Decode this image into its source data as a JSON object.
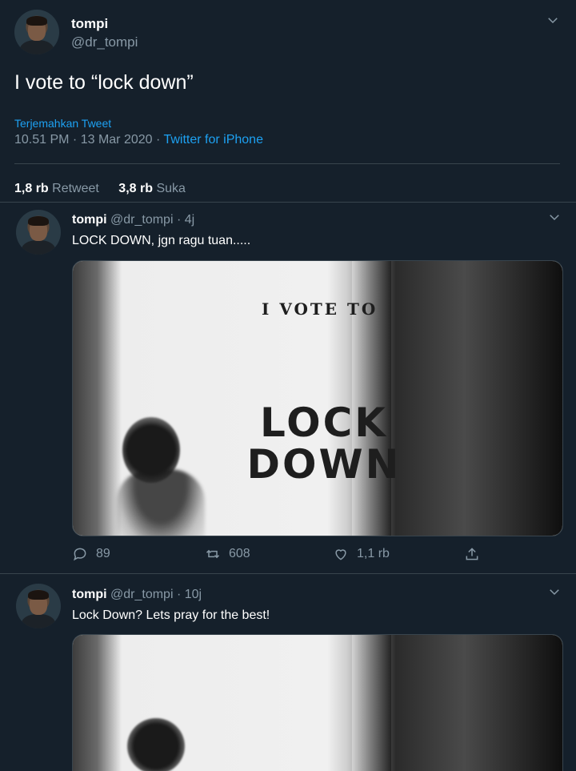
{
  "main_tweet": {
    "name": "tompi",
    "handle": "@dr_tompi",
    "text": "I vote to “lock down”",
    "translate_label": "Terjemahkan Tweet",
    "timestamp": "10.51 PM · 13 Mar 2020 ·",
    "client": "Twitter for iPhone",
    "retweet_count": "1,8 rb",
    "retweet_label": "Retweet",
    "like_count": "3,8 rb",
    "like_label": "Suka"
  },
  "replies": [
    {
      "name": "tompi",
      "handle_time": "@dr_tompi · 4j",
      "text": "LOCK DOWN, jgn ragu tuan.....",
      "image_text_small": "I VOTE TO",
      "image_text_big_line1": "LOCK",
      "image_text_big_line2": "DOWN",
      "reply_count": "89",
      "retweet_count": "608",
      "like_count": "1,1 rb"
    },
    {
      "name": "tompi",
      "handle_time": "@dr_tompi · 10j",
      "text": "Lock Down? Lets pray for the best!"
    }
  ],
  "icons": {
    "chevron": "chevron-down-icon",
    "reply": "reply-icon",
    "retweet": "retweet-icon",
    "like": "heart-icon",
    "share": "share-icon"
  },
  "colors": {
    "background": "#15202b",
    "accent": "#1da1f2",
    "muted": "#8899a6",
    "divider": "#38444d"
  }
}
